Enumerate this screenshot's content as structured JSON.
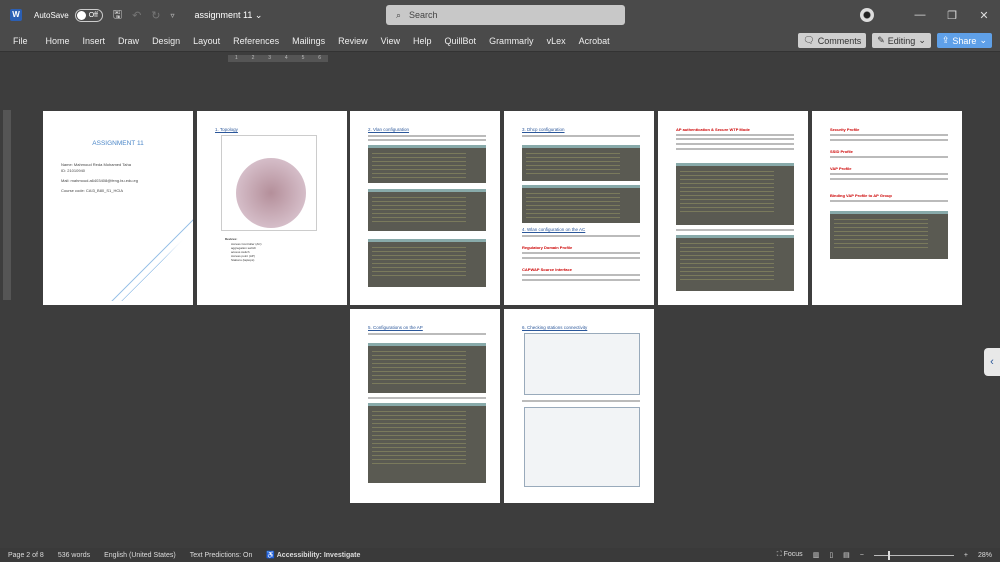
{
  "app": {
    "logo": "W",
    "autosave_label": "AutoSave",
    "autosave_state": "Off",
    "doc_title": "assignment 11",
    "search_placeholder": "Search"
  },
  "ribbon": {
    "tabs": [
      "File",
      "Home",
      "Insert",
      "Draw",
      "Design",
      "Layout",
      "References",
      "Mailings",
      "Review",
      "View",
      "Help",
      "QuillBot",
      "Grammarly",
      "vLex",
      "Acrobat"
    ],
    "comments": "Comments",
    "editing": "Editing",
    "share": "Share"
  },
  "ruler": {
    "marks": [
      "1",
      "2",
      "3",
      "4",
      "5",
      "6"
    ]
  },
  "pages": {
    "cover": {
      "title": "ASSIGNMENT 11",
      "name": "Name: Mahmoud Reda Mohamed Taha",
      "id": "ID: 21010940",
      "mail": "Mail: mahmoud.a6403408@feng.bu.edu.eg",
      "course": "Course code: CAI3_B80_S1_HCIA"
    },
    "p2": {
      "heading": "1. Topology",
      "legend_title": "Devices:",
      "legend": [
        "Access Controller (AC)",
        "aggregation switch",
        "access switch",
        "Access point (AP)",
        "Stations (laptops)"
      ]
    },
    "p3": {
      "heading": "2. Vlan configuration"
    },
    "p4": {
      "heading": "3. Dhcp configuration",
      "heading2": "4. Wlan configuration on the AC",
      "sub1": "Regulatory Domain Profile",
      "sub2": "CAPWAP Source Interface"
    },
    "p5": {
      "heading": "AP authentication & Secure WTP Mode"
    },
    "p6": {
      "sub1": "Security Profile",
      "sub2": "SSID Profile",
      "sub3": "VAP Profile",
      "sub4": "Binding VAP Profile to AP Group"
    },
    "p7": {
      "heading": "5. Configurations on the AP"
    },
    "p8": {
      "heading": "6. Checking stations connectivity"
    }
  },
  "status": {
    "page": "Page 2 of 8",
    "words": "536 words",
    "language": "English (United States)",
    "predictions": "Text Predictions: On",
    "accessibility": "Accessibility: Investigate",
    "focus": "Focus",
    "zoom": "28%",
    "zoom_percent": 28
  }
}
